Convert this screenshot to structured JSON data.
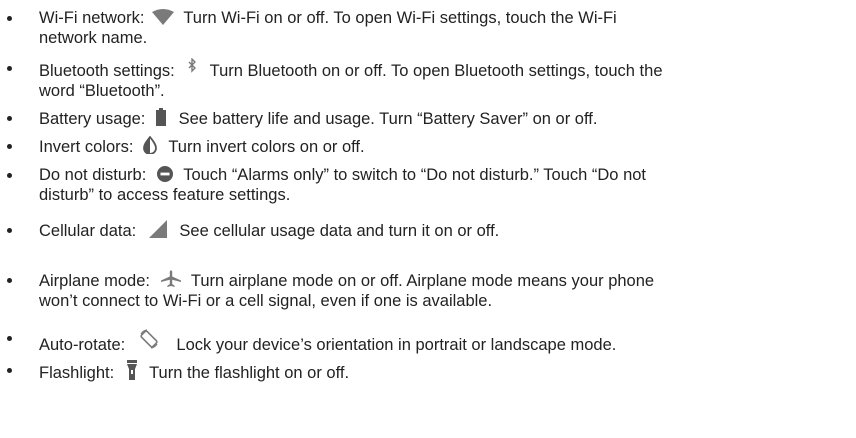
{
  "items": [
    {
      "label": "Wi-Fi network:",
      "icon": "wifi-icon",
      "desc": "Turn Wi-Fi on or off. To open Wi-Fi settings, touch the Wi-Fi",
      "desc2": "network name."
    },
    {
      "label": "Bluetooth settings:",
      "icon": "bluetooth-icon",
      "desc": "Turn Bluetooth on or off. To open Bluetooth settings, touch the",
      "desc2": "word “Bluetooth”."
    },
    {
      "label": "Battery usage:",
      "icon": "battery-icon",
      "desc": "See battery life and usage. Turn “Battery Saver” on or off."
    },
    {
      "label": "Invert colors:",
      "icon": "invert-colors-icon",
      "desc": "Turn invert colors on or off."
    },
    {
      "label": "Do not disturb:",
      "icon": "do-not-disturb-icon",
      "desc": "Touch “Alarms only” to switch to “Do not disturb.” Touch “Do not",
      "desc2": "disturb” to access feature settings."
    },
    {
      "label": "Cellular data:",
      "icon": "cellular-signal-icon",
      "desc": "See cellular usage data and turn it on or off."
    },
    {
      "label": "Airplane mode:",
      "icon": "airplane-icon",
      "desc": "Turn airplane mode on or off. Airplane mode means your phone",
      "desc2": "won’t connect to Wi-Fi or a cell signal, even if one is available."
    },
    {
      "label": "Auto-rotate:",
      "icon": "auto-rotate-icon",
      "desc": "Lock your device’s orientation in portrait or landscape mode."
    },
    {
      "label": "Flashlight:",
      "icon": "flashlight-icon",
      "desc": "Turn the flashlight on or off."
    }
  ],
  "colors": {
    "text": "#222222",
    "icon": "#7a7a7a",
    "icon_dark": "#555555"
  }
}
